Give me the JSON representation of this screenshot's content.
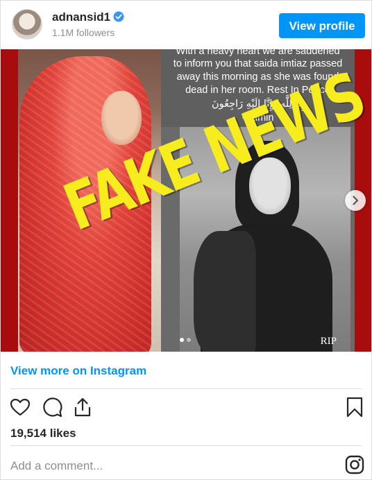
{
  "header": {
    "username": "adnansid1",
    "followers": "1.1M followers",
    "view_profile_label": "View profile"
  },
  "post": {
    "caption_lines": [
      "With a heavy heart we are saddened",
      "to inform you that saida imtiaz passed",
      "away this morning as she was found",
      "dead in her room. Rest In Peace",
      "إِنَّا لِلَّٰهِ وَإِنَّا إِلَيْهِ رَاجِعُونَ",
      "-Admin"
    ],
    "overlay_text": "FAKE NEWS",
    "photo_label": "RIP",
    "carousel_total": 2,
    "carousel_active": 1
  },
  "footer": {
    "view_more_label": "View more on Instagram",
    "likes": "19,514 likes",
    "comment_placeholder": "Add a comment..."
  },
  "colors": {
    "accent": "#0095f6",
    "overlay_yellow": "#f7ec1d",
    "frame_red": "#a80c0c"
  },
  "icons": [
    "verified-badge-icon",
    "heart-icon",
    "comment-icon",
    "share-icon",
    "bookmark-icon",
    "chevron-right-icon",
    "instagram-logo-icon"
  ]
}
